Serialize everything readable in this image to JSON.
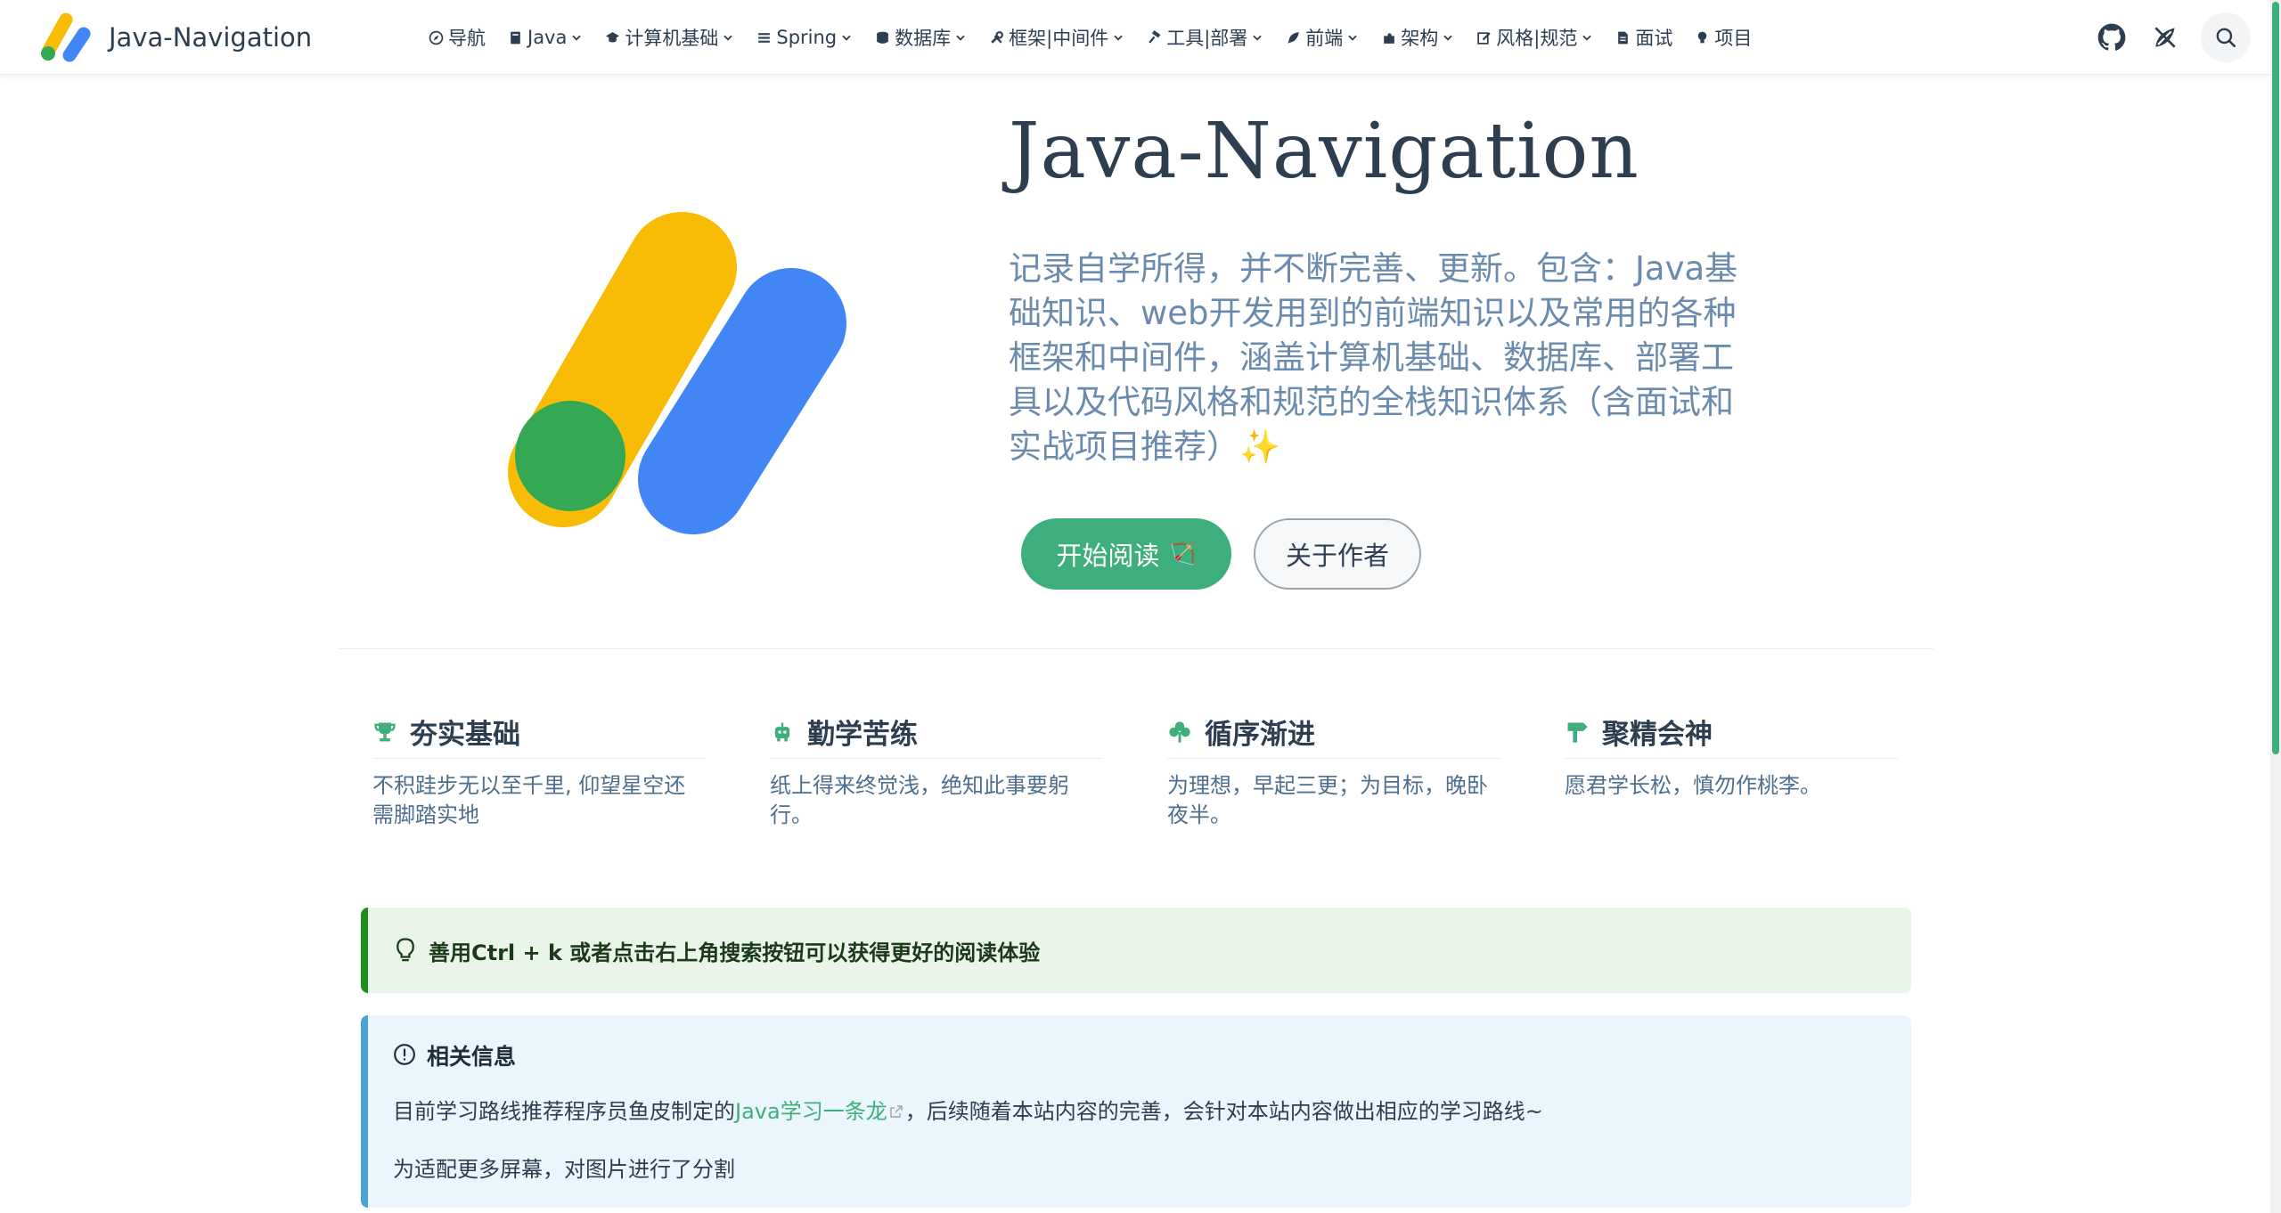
{
  "brand": {
    "name": "Java-Navigation"
  },
  "nav": {
    "items": [
      {
        "label": "导航",
        "icon": "compass-icon",
        "dropdown": false
      },
      {
        "label": "Java",
        "icon": "book-icon",
        "dropdown": true
      },
      {
        "label": "计算机基础",
        "icon": "graduation-cap-icon",
        "dropdown": true
      },
      {
        "label": "Spring",
        "icon": "leaf-stack-icon",
        "dropdown": true
      },
      {
        "label": "数据库",
        "icon": "database-icon",
        "dropdown": true
      },
      {
        "label": "框架|中间件",
        "icon": "tools-icon",
        "dropdown": true
      },
      {
        "label": "工具|部署",
        "icon": "hammer-icon",
        "dropdown": true
      },
      {
        "label": "前端",
        "icon": "feather-icon",
        "dropdown": true
      },
      {
        "label": "架构",
        "icon": "puzzle-icon",
        "dropdown": true
      },
      {
        "label": "风格|规范",
        "icon": "edit-icon",
        "dropdown": true
      },
      {
        "label": "面试",
        "icon": "document-icon",
        "dropdown": false
      },
      {
        "label": "项目",
        "icon": "lightbulb-icon",
        "dropdown": false
      }
    ]
  },
  "hero": {
    "title": "Java-Navigation",
    "description": "记录自学所得，并不断完善、更新。包含：Java基础知识、web开发用到的前端知识以及常用的各种框架和中间件，涵盖计算机基础、数据库、部署工具以及代码风格和规范的全栈知识体系（含面试和实战项目推荐）✨",
    "primary_button": "开始阅读",
    "primary_emoji": "🏹",
    "secondary_button": "关于作者"
  },
  "features": [
    {
      "title": "夯实基础",
      "text": "不积跬步无以至千里, 仰望星空还需脚踏实地",
      "icon": "trophy-icon"
    },
    {
      "title": "勤学苦练",
      "text": "纸上得来终觉浅，绝知此事要躬行。",
      "icon": "robot-icon"
    },
    {
      "title": "循序渐进",
      "text": "为理想，早起三更；为目标，晚卧夜半。",
      "icon": "clover-icon"
    },
    {
      "title": "聚精会神",
      "text": "愿君学长松，慎勿作桃李。",
      "icon": "signpost-icon"
    }
  ],
  "tip": {
    "text": "善用Ctrl + k 或者点击右上角搜索按钮可以获得更好的阅读体验",
    "icon": "lightbulb-outline-icon"
  },
  "info": {
    "title": "相关信息",
    "icon": "info-circle-icon",
    "line1_before": "目前学习路线推荐程序员鱼皮制定的",
    "line1_link": "Java学习一条龙",
    "line1_after": "，后续随着本站内容的完善，会针对本站内容做出相应的学习路线~",
    "line2": "为适配更多屏幕，对图片进行了分割"
  },
  "colors": {
    "accent": "#3eaf7c",
    "logo_yellow": "#f9bc05",
    "logo_blue": "#4285f4",
    "logo_green": "#34a853"
  }
}
